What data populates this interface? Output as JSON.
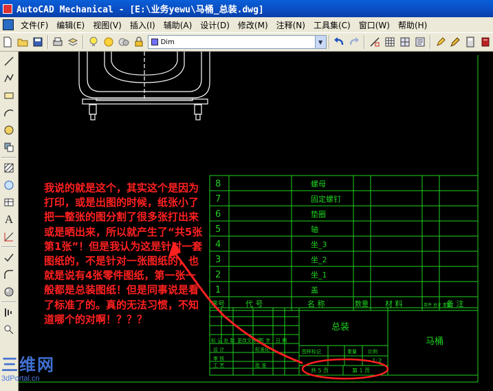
{
  "window": {
    "title": "AutoCAD Mechanical - [E:\\业务yewu\\马桶_总装.dwg]"
  },
  "menu": {
    "items": [
      "文件(F)",
      "编辑(E)",
      "视图(V)",
      "插入(I)",
      "辅助(A)",
      "设计(D)",
      "修改(M)",
      "注释(N)",
      "工具集(C)",
      "窗口(W)",
      "帮助(H)"
    ]
  },
  "toolbar": {
    "layer_value": "Dim"
  },
  "annotation": {
    "text": "我说的就是这个，其实这个是因为打印，或是出图的时候，纸张小了把一整张的图分割了很多张打出来或是晒出来，所以就产生了“共5张第1张”！但是我认为这是针对一套图纸的，不是针对一张图纸的，也就是说有4张零件图纸，第一张一般都是总装图纸！但是同事说是看了标准了的。真的无法习惯，不知道哪个的对啊！？？？"
  },
  "bom": {
    "rows": [
      {
        "num": "8",
        "name": "螺母"
      },
      {
        "num": "7",
        "name": "固定螺钉"
      },
      {
        "num": "6",
        "name": "垫圈"
      },
      {
        "num": "5",
        "name": "轴"
      },
      {
        "num": "4",
        "name": "坐_3"
      },
      {
        "num": "3",
        "name": "坐_2"
      },
      {
        "num": "2",
        "name": "坐_1"
      },
      {
        "num": "1",
        "name": "盖"
      }
    ],
    "headers": {
      "seq": "序号",
      "code": "代  号",
      "name": "名  称",
      "qty": "数量",
      "material": "材  料",
      "weight": "单件 总计 重量",
      "note": "备  注"
    }
  },
  "title_block": {
    "drawing_name": "总装",
    "part_name": "马桶",
    "left_labels": [
      "标 记 处 数",
      "更改文件号",
      "签 字",
      "日 期",
      "设 计",
      "标准化",
      "审 核",
      "工 艺",
      "批 准"
    ],
    "stage_labels": [
      "图样标记",
      "重量",
      "比例"
    ],
    "scale": "1:2",
    "sheets_total": "共 5 页",
    "sheet_num": "第 1 页"
  },
  "watermark": {
    "top": "三维网",
    "bottom": "3dPortal.cn"
  },
  "colors": {
    "drawing_line": "#1fd31f",
    "annotation": "#ff2020",
    "arrow": "#ff2020",
    "titlebar": "#0a4ec2",
    "chrome": "#ece9d8"
  }
}
